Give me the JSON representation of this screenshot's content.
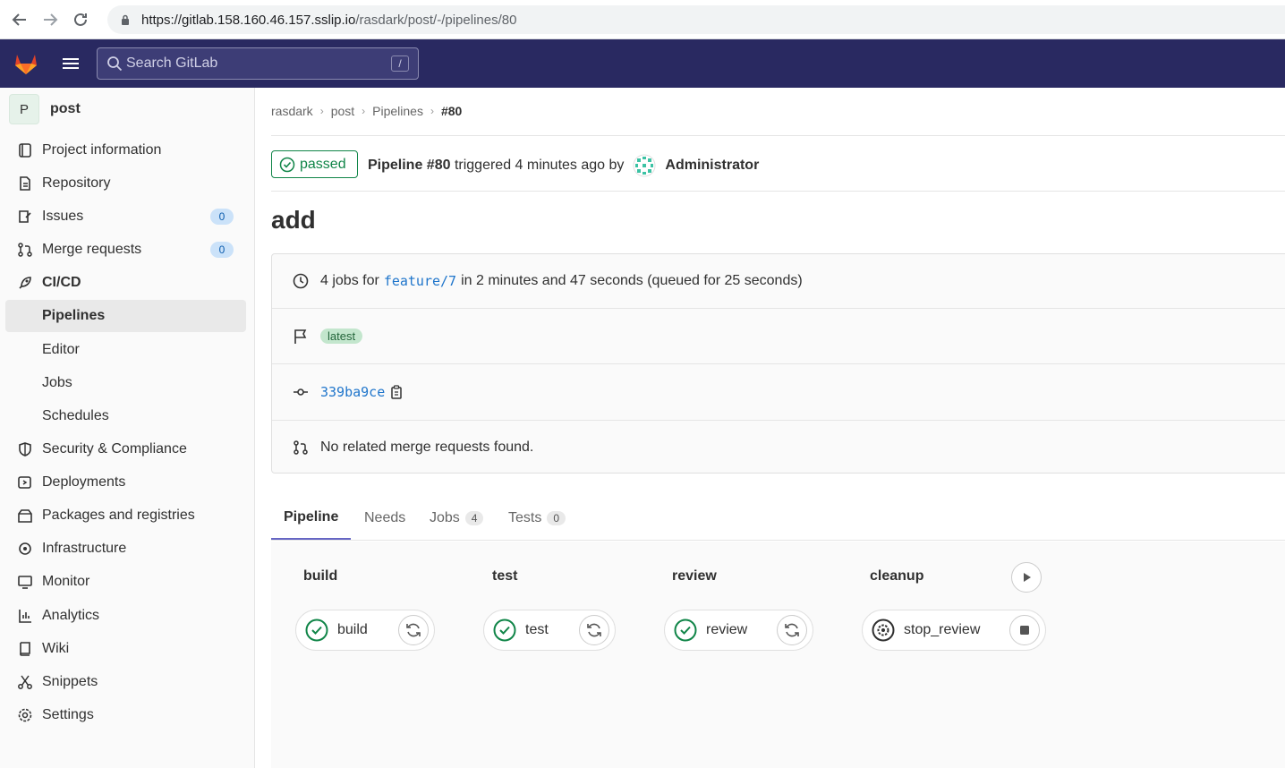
{
  "browser": {
    "url_host": "https://gitlab.158.160.46.157.sslip.io",
    "url_path": "/rasdark/post/-/pipelines/80"
  },
  "topbar": {
    "search_placeholder": "Search GitLab",
    "search_shortcut": "/"
  },
  "sidebar": {
    "project_initial": "P",
    "project_name": "post",
    "items": [
      {
        "label": "Project information",
        "icon": "info-icon"
      },
      {
        "label": "Repository",
        "icon": "doc-icon"
      },
      {
        "label": "Issues",
        "icon": "issues-icon",
        "badge": "0"
      },
      {
        "label": "Merge requests",
        "icon": "merge-request-icon",
        "badge": "0"
      },
      {
        "label": "CI/CD",
        "icon": "rocket-icon"
      },
      {
        "label": "Pipelines"
      },
      {
        "label": "Editor"
      },
      {
        "label": "Jobs"
      },
      {
        "label": "Schedules"
      },
      {
        "label": "Security & Compliance",
        "icon": "shield-icon"
      },
      {
        "label": "Deployments",
        "icon": "deployments-icon"
      },
      {
        "label": "Packages and registries",
        "icon": "package-icon"
      },
      {
        "label": "Infrastructure",
        "icon": "cloud-gear-icon"
      },
      {
        "label": "Monitor",
        "icon": "monitor-icon"
      },
      {
        "label": "Analytics",
        "icon": "chart-icon"
      },
      {
        "label": "Wiki",
        "icon": "book-icon"
      },
      {
        "label": "Snippets",
        "icon": "scissors-icon"
      },
      {
        "label": "Settings",
        "icon": "gear-icon"
      }
    ]
  },
  "breadcrumb": {
    "items": [
      "rasdark",
      "post",
      "Pipelines"
    ],
    "current": "#80"
  },
  "pipeline": {
    "status": "passed",
    "label": "Pipeline #80",
    "triggered": "triggered 4 minutes ago by",
    "user": "Administrator",
    "title": "add",
    "jobs_prefix": "4 jobs for",
    "branch": "feature/7",
    "jobs_suffix": "in 2 minutes and 47 seconds (queued for 25 seconds)",
    "tag": "latest",
    "commit": "339ba9ce",
    "merge_requests": "No related merge requests found."
  },
  "tabs": [
    {
      "label": "Pipeline"
    },
    {
      "label": "Needs"
    },
    {
      "label": "Jobs",
      "count": "4"
    },
    {
      "label": "Tests",
      "count": "0"
    }
  ],
  "stages": [
    {
      "name": "build",
      "job": "build",
      "status": "passed",
      "action": "retry"
    },
    {
      "name": "test",
      "job": "test",
      "status": "passed",
      "action": "retry"
    },
    {
      "name": "review",
      "job": "review",
      "status": "passed",
      "action": "retry"
    },
    {
      "name": "cleanup",
      "job": "stop_review",
      "status": "manual",
      "action": "stop"
    }
  ],
  "colors": {
    "topbar": "#292961",
    "success": "#108548",
    "link": "#1f75cb"
  }
}
